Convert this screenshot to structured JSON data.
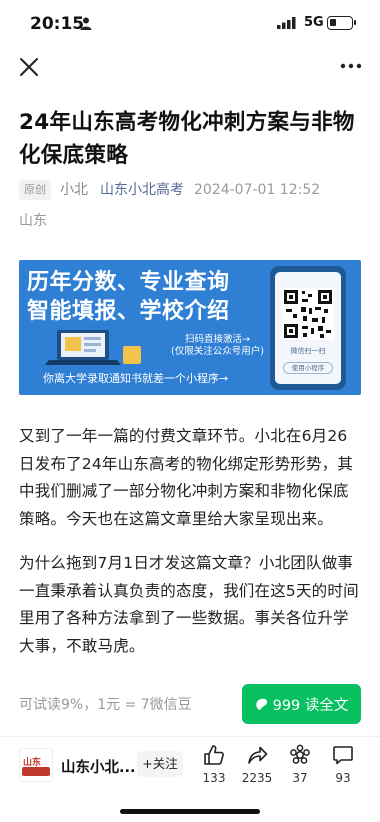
{
  "status_bar": {
    "time": "20:15",
    "network": "5G"
  },
  "article": {
    "title": "24年山东高考物化冲刺方案与非物化保底策略",
    "original_tag": "原创",
    "author": "小北",
    "account": "山东小北高考",
    "publish_time": "2024-07-01 12:52",
    "location": "山东"
  },
  "banner": {
    "line1": "历年分数、专业查询",
    "line2": "智能填报、学校介绍",
    "scan_line1": "扫码直接激活→",
    "scan_line2": "(仅限关注公众号用户)",
    "bottom_text": "你离大学录取通知书就差一个小程序→",
    "phone_caption": "微信扫一扫",
    "phone_button": "使用小程序"
  },
  "paragraphs": [
    "又到了一年一篇的付费文章环节。小北在6月26日发布了24年山东高考的物化绑定形势形势，其中我们删减了一部分物化冲刺方案和非物化保底策略。今天也在这篇文章里给大家呈现出来。",
    "为什么拖到7月1日才发这篇文章？小北团队做事一直秉承着认真负责的态度，我们在这5天的时间里用了各种方法拿到了一些数据。事关各位升学大事，不敢马虎。"
  ],
  "paywall": {
    "trial_info": "可试读9%，1元 = 7微信豆",
    "read_button": "999 读全文"
  },
  "bottom_bar": {
    "account_name": "山东小北...",
    "follow_label": "+关注",
    "avatar_text": "山东",
    "like_count": "133",
    "share_count": "2235",
    "wow_count": "37",
    "comment_count": "93"
  },
  "icons": {
    "close": "close-icon",
    "more": "more-icon",
    "like": "thumbs-up-icon",
    "share": "share-icon",
    "wow": "wow-icon",
    "comment": "comment-icon",
    "bean": "wechat-bean-icon"
  },
  "colors": {
    "accent_green": "#07c160",
    "link_blue": "#576b95",
    "banner_blue": "#2f7fd4"
  }
}
